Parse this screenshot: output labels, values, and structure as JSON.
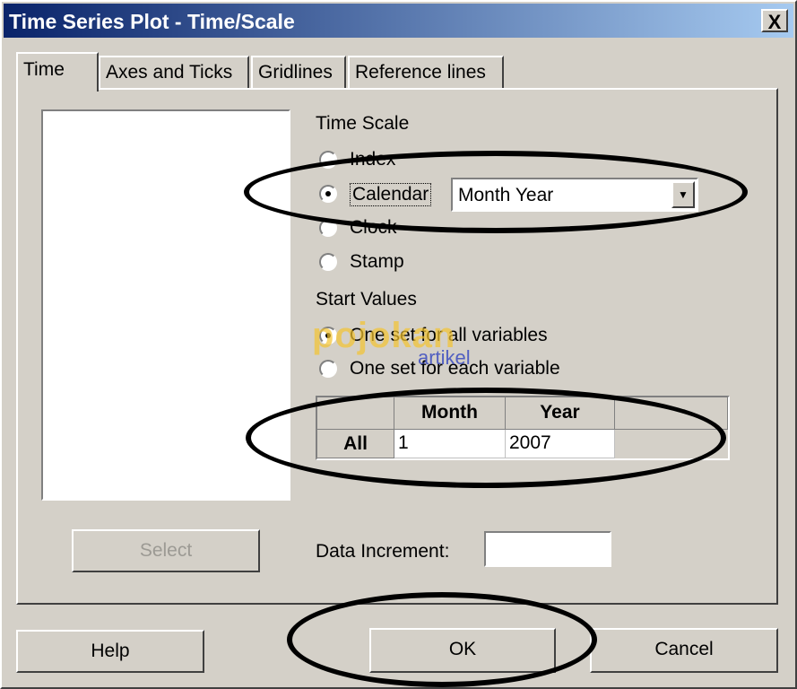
{
  "window": {
    "title": "Time Series Plot - Time/Scale",
    "close_glyph": "X"
  },
  "tabs": [
    {
      "label": "Time",
      "active": true
    },
    {
      "label": "Axes and Ticks",
      "active": false
    },
    {
      "label": "Gridlines",
      "active": false
    },
    {
      "label": "Reference lines",
      "active": false
    }
  ],
  "time_scale": {
    "heading": "Time Scale",
    "options": [
      {
        "label": "Index",
        "checked": false
      },
      {
        "label": "Calendar",
        "checked": true
      },
      {
        "label": "Clock",
        "checked": false
      },
      {
        "label": "Stamp",
        "checked": false
      }
    ],
    "calendar_select": {
      "value": "Month Year"
    }
  },
  "start_values": {
    "heading": "Start Values",
    "options": [
      {
        "label": "One set for all variables",
        "checked": true
      },
      {
        "label": "One set for each variable",
        "checked": false
      }
    ],
    "table": {
      "columns": [
        "Month",
        "Year"
      ],
      "rows": [
        {
          "label": "All",
          "values": [
            "1",
            "2007"
          ]
        }
      ]
    }
  },
  "data_increment": {
    "label": "Data Increment:",
    "value": ""
  },
  "buttons": {
    "select": "Select",
    "help": "Help",
    "ok": "OK",
    "cancel": "Cancel"
  },
  "watermark": {
    "main": "pojokan",
    "sub": "artikel"
  }
}
